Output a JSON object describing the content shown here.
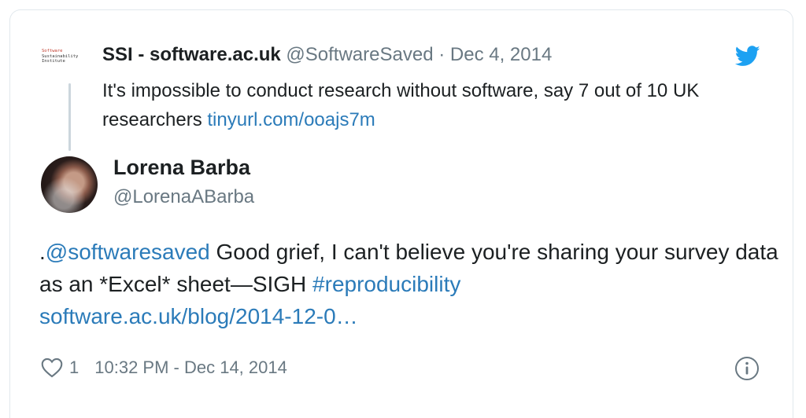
{
  "quoted_tweet": {
    "logo_lines": [
      "Software",
      "Sustainability",
      "Institute"
    ],
    "name": "SSI - software.ac.uk",
    "handle": "@SoftwareSaved",
    "separator": "·",
    "date": "Dec 4, 2014",
    "text": "It's impossible to conduct research without software, say 7 out of 10 UK researchers ",
    "link": "tinyurl.com/ooajs7m"
  },
  "tweet": {
    "author_name": "Lorena Barba",
    "author_handle": "@LorenaABarba",
    "text_prefix": ".",
    "mention": "@softwaresaved",
    "text_middle": " Good grief, I can't believe you're sharing your survey data as an *Excel* sheet—SIGH ",
    "hashtag": "#reproducibility",
    "link": "software.ac.uk/blog/2014-12-0…"
  },
  "footer": {
    "like_count": "1",
    "timestamp": "10:32 PM - Dec 14, 2014"
  },
  "colors": {
    "link": "#2b7bb9",
    "twitter_blue": "#1da1f2",
    "secondary_text": "#697882"
  },
  "icons": [
    "twitter-bird-icon",
    "heart-icon",
    "info-icon"
  ]
}
